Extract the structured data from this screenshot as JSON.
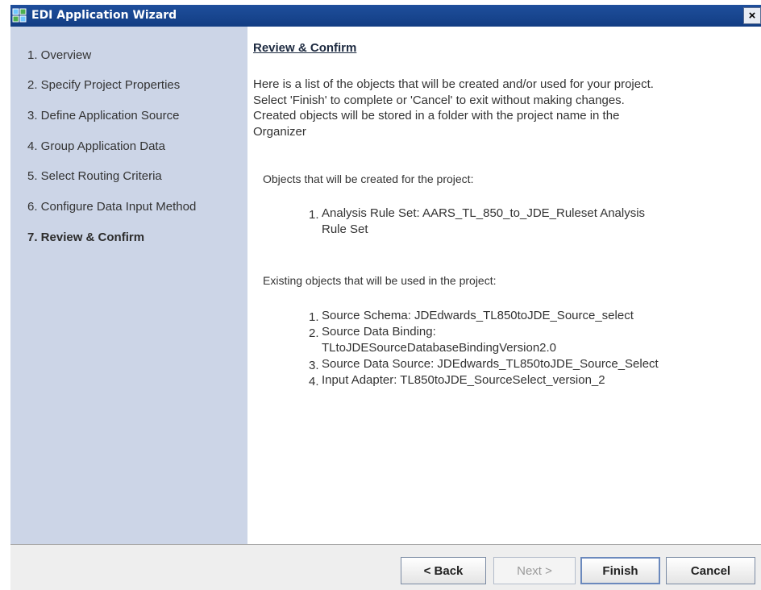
{
  "window": {
    "title": "EDI Application Wizard",
    "close_label": "×"
  },
  "steps": [
    {
      "label": "1. Overview",
      "active": false
    },
    {
      "label": "2. Specify Project Properties",
      "active": false
    },
    {
      "label": "3. Define Application Source",
      "active": false
    },
    {
      "label": "4. Group Application Data",
      "active": false
    },
    {
      "label": "5. Select Routing Criteria",
      "active": false
    },
    {
      "label": "6. Configure Data Input Method",
      "active": false
    },
    {
      "label": "7. Review & Confirm",
      "active": true
    }
  ],
  "main": {
    "title": "Review & Confirm",
    "intro_lines": [
      "Here is a list of the objects that will be created and/or used for your project.",
      "Select 'Finish' to complete or 'Cancel' to exit without making changes.",
      "Created objects will be stored in a folder with the project name in the",
      "Organizer"
    ],
    "created_heading": "Objects that will be created for the project:",
    "created_items": [
      {
        "num": "1.",
        "lines": [
          "Analysis Rule Set: AARS_TL_850_to_JDE_Ruleset Analysis",
          "Rule Set"
        ]
      }
    ],
    "existing_heading": "Existing objects that will be used in the project:",
    "existing_items": [
      {
        "num": "1.",
        "lines": [
          "Source Schema: JDEdwards_TL850toJDE_Source_select"
        ]
      },
      {
        "num": "2.",
        "lines": [
          "Source Data Binding:",
          "TLtoJDESourceDatabaseBindingVersion2.0"
        ]
      },
      {
        "num": "3.",
        "lines": [
          "Source Data Source: JDEdwards_TL850toJDE_Source_Select"
        ]
      },
      {
        "num": "4.",
        "lines": [
          "Input Adapter: TL850toJDE_SourceSelect_version_2"
        ]
      }
    ]
  },
  "footer": {
    "back_label": "< Back",
    "next_label": "Next >",
    "finish_label": "Finish",
    "cancel_label": "Cancel"
  },
  "colors": {
    "titlebar": "#1f4f9c",
    "sidebar": "#ccd5e7",
    "footer": "#eeeeee"
  }
}
